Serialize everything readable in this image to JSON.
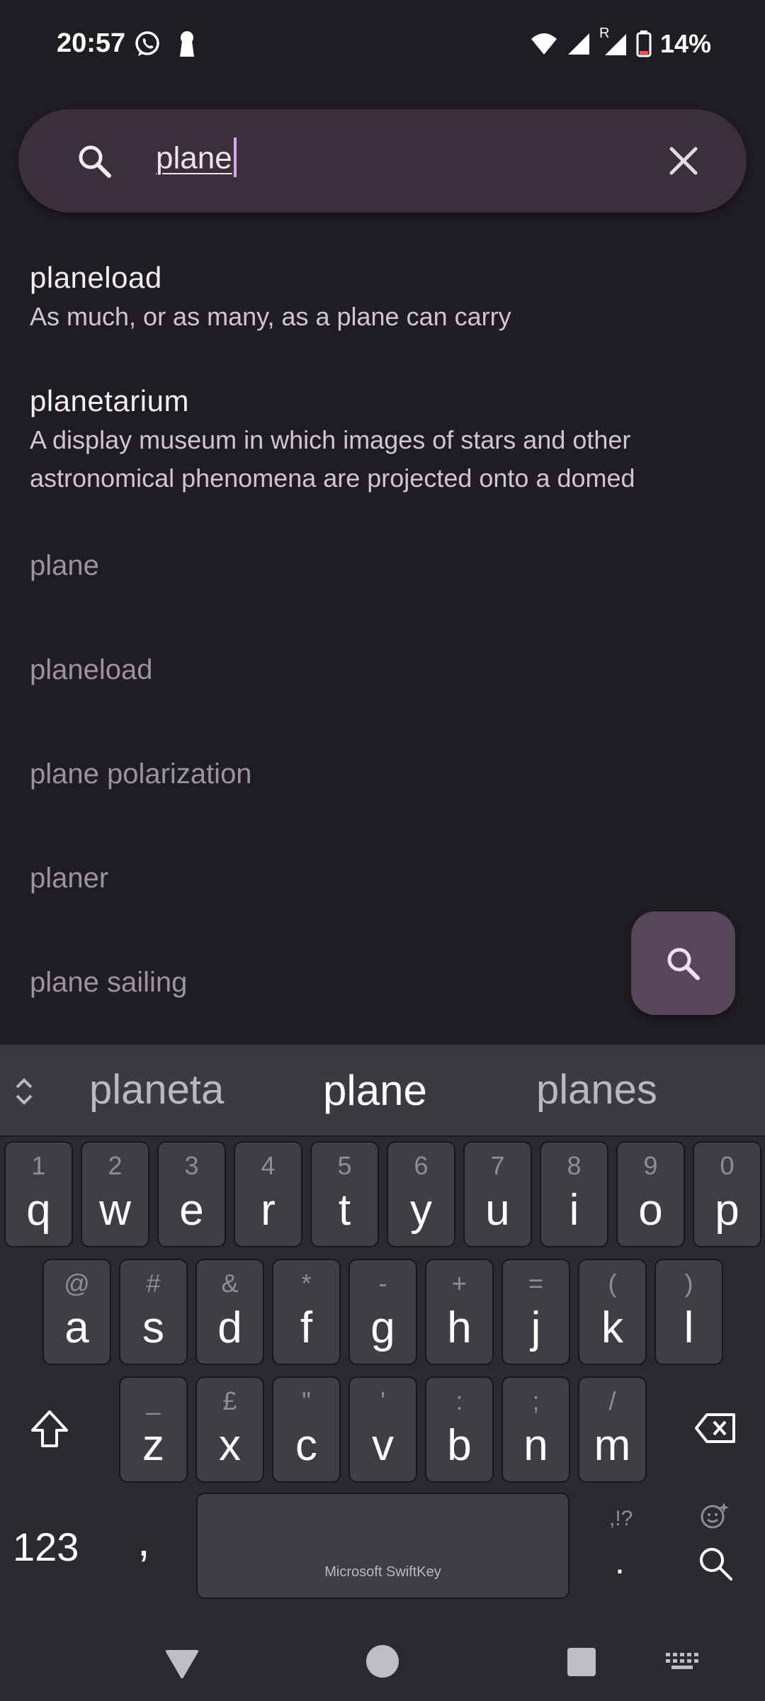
{
  "status_bar": {
    "time": "20:57",
    "icons_left": [
      "whatsapp-icon",
      "keyhole-icon"
    ],
    "icons_right": [
      "wifi-icon",
      "signal-icon",
      "roaming-signal-icon",
      "battery-icon"
    ],
    "roaming_label": "R",
    "battery_percent": "14%"
  },
  "search": {
    "query": "plane",
    "search_icon": "search-icon",
    "clear_icon": "close-icon"
  },
  "results": [
    {
      "word": "planeload",
      "definition": "As much, or as many, as a plane can carry"
    },
    {
      "word": "planetarium",
      "definition_line1": "A display museum in which images of stars and other",
      "definition_line2": "astronomical phenomena are projected onto a domed"
    }
  ],
  "suggestions": [
    "plane",
    "planeload",
    "plane polarization",
    "planer",
    "plane sailing"
  ],
  "fab": {
    "icon": "search-icon"
  },
  "keyboard": {
    "predictions": [
      "planeta",
      "plane",
      "planes"
    ],
    "row1": [
      {
        "hint": "1",
        "key": "q"
      },
      {
        "hint": "2",
        "key": "w"
      },
      {
        "hint": "3",
        "key": "e"
      },
      {
        "hint": "4",
        "key": "r"
      },
      {
        "hint": "5",
        "key": "t"
      },
      {
        "hint": "6",
        "key": "y"
      },
      {
        "hint": "7",
        "key": "u"
      },
      {
        "hint": "8",
        "key": "i"
      },
      {
        "hint": "9",
        "key": "o"
      },
      {
        "hint": "0",
        "key": "p"
      }
    ],
    "row2": [
      {
        "hint": "@",
        "key": "a"
      },
      {
        "hint": "#",
        "key": "s"
      },
      {
        "hint": "&",
        "key": "d"
      },
      {
        "hint": "*",
        "key": "f"
      },
      {
        "hint": "-",
        "key": "g"
      },
      {
        "hint": "+",
        "key": "h"
      },
      {
        "hint": "=",
        "key": "j"
      },
      {
        "hint": "(",
        "key": "k"
      },
      {
        "hint": ")",
        "key": "l"
      }
    ],
    "row3": [
      {
        "hint": "_",
        "key": "z"
      },
      {
        "hint": "£",
        "key": "x"
      },
      {
        "hint": "\"",
        "key": "c"
      },
      {
        "hint": "'",
        "key": "v"
      },
      {
        "hint": ":",
        "key": "b"
      },
      {
        "hint": ";",
        "key": "n"
      },
      {
        "hint": "/",
        "key": "m"
      }
    ],
    "numbers_label": "123",
    "comma_label": ",",
    "space_label": "Microsoft SwiftKey",
    "punct_hint": ",!?",
    "period_label": ".",
    "icons": [
      "shift-icon",
      "backspace-icon",
      "emoji-icon",
      "search-icon",
      "expand-icon"
    ]
  },
  "nav_bar": {
    "icons": [
      "back-icon",
      "home-icon",
      "recents-icon",
      "keyboard-icon"
    ]
  }
}
